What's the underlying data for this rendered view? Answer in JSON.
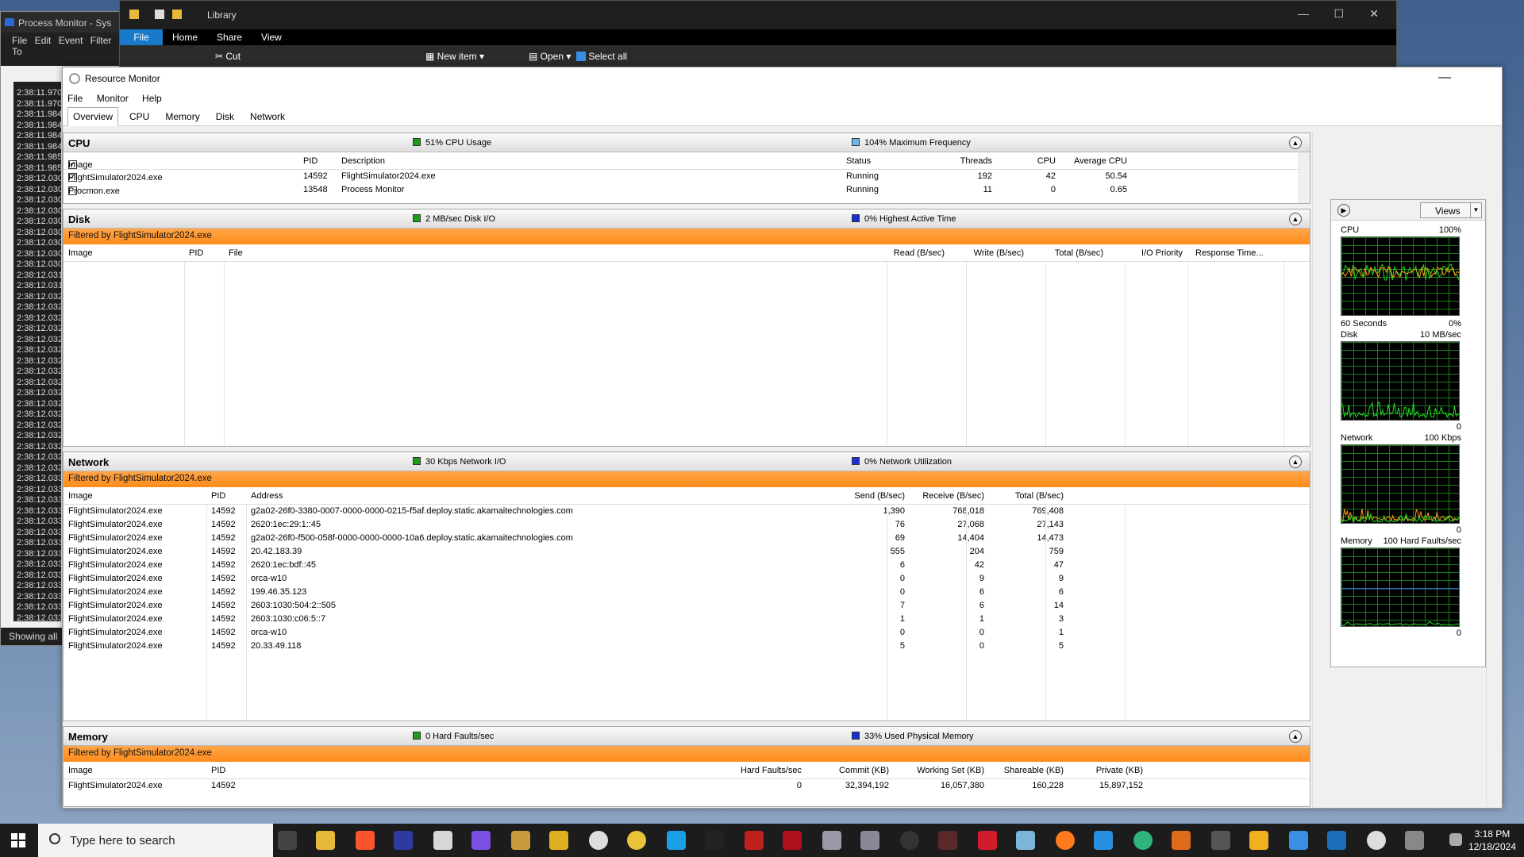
{
  "procmon": {
    "title": "Process Monitor - Sys",
    "menu": [
      "File",
      "Edit",
      "Event",
      "Filter",
      "To"
    ],
    "times": [
      "2:38:11.970",
      "2:38:11.970",
      "2:38:11.984",
      "2:38:11.984",
      "2:38:11.984",
      "2:38:11.984",
      "2:38:11.985",
      "2:38:11.985",
      "2:38:12.030",
      "2:38:12.030",
      "2:38:12.030",
      "2:38:12.030",
      "2:38:12.030",
      "2:38:12.030",
      "2:38:12.030",
      "2:38:12.030",
      "2:38:12.030",
      "2:38:12.031",
      "2:38:12.031",
      "2:38:12.032",
      "2:38:12.032",
      "2:38:12.032",
      "2:38:12.032",
      "2:38:12.032",
      "2:38:12.032",
      "2:38:12.032",
      "2:38:12.032",
      "2:38:12.032",
      "2:38:12.032",
      "2:38:12.032",
      "2:38:12.032",
      "2:38:12.032",
      "2:38:12.032",
      "2:38:12.032",
      "2:38:12.032",
      "2:38:12.032",
      "2:38:12.033",
      "2:38:12.033",
      "2:38:12.033",
      "2:38:12.033",
      "2:38:12.033",
      "2:38:12.033",
      "2:38:12.033",
      "2:38:12.033",
      "2:38:12.033",
      "2:38:12.033",
      "2:38:12.033",
      "2:38:12.033",
      "2:38:12.033",
      "2:38:12.033"
    ],
    "status": "Showing all"
  },
  "explorer": {
    "title": "Library",
    "ribbon": {
      "file": "File",
      "home": "Home",
      "share": "Share",
      "view": "View"
    },
    "tools": {
      "cut": "Cut",
      "new_item": "New item",
      "open": "Open",
      "select_all": "Select all"
    }
  },
  "rm": {
    "title": "Resource Monitor",
    "menu": {
      "file": "File",
      "monitor": "Monitor",
      "help": "Help"
    },
    "tabs": {
      "overview": "Overview",
      "cpu": "CPU",
      "memory": "Memory",
      "disk": "Disk",
      "network": "Network"
    },
    "cpu": {
      "name": "CPU",
      "ind1": "51% CPU Usage",
      "ind2": "104% Maximum Frequency",
      "cols": {
        "image": "Image",
        "pid": "PID",
        "desc": "Description",
        "status": "Status",
        "threads": "Threads",
        "cpu": "CPU",
        "avg": "Average CPU"
      },
      "rows": [
        {
          "checked": true,
          "image": "FlightSimulator2024.exe",
          "pid": "14592",
          "desc": "FlightSimulator2024.exe",
          "status": "Running",
          "threads": "192",
          "cpu": "42",
          "avg": "50.54"
        },
        {
          "checked": false,
          "image": "Procmon.exe",
          "pid": "13548",
          "desc": "Process Monitor",
          "status": "Running",
          "threads": "11",
          "cpu": "0",
          "avg": "0.65"
        }
      ]
    },
    "disk": {
      "name": "Disk",
      "ind1": "2 MB/sec Disk I/O",
      "ind2": "0% Highest Active Time",
      "filter": "Filtered by FlightSimulator2024.exe",
      "cols": {
        "image": "Image",
        "pid": "PID",
        "file": "File",
        "read": "Read (B/sec)",
        "write": "Write (B/sec)",
        "total": "Total (B/sec)",
        "prio": "I/O Priority",
        "resp": "Response Time..."
      }
    },
    "network": {
      "name": "Network",
      "ind1": "30 Kbps Network I/O",
      "ind2": "0% Network Utilization",
      "filter": "Filtered by FlightSimulator2024.exe",
      "cols": {
        "image": "Image",
        "pid": "PID",
        "address": "Address",
        "send": "Send (B/sec)",
        "recv": "Receive (B/sec)",
        "total": "Total (B/sec)"
      },
      "rows": [
        {
          "image": "FlightSimulator2024.exe",
          "pid": "14592",
          "address": "g2a02-26f0-3380-0007-0000-0000-0215-f5af.deploy.static.akamaitechnologies.com",
          "send": "1,390",
          "recv": "768,018",
          "total": "769,408"
        },
        {
          "image": "FlightSimulator2024.exe",
          "pid": "14592",
          "address": "2620:1ec:29:1::45",
          "send": "76",
          "recv": "27,068",
          "total": "27,143"
        },
        {
          "image": "FlightSimulator2024.exe",
          "pid": "14592",
          "address": "g2a02-26f0-f500-058f-0000-0000-0000-10a6.deploy.static.akamaitechnologies.com",
          "send": "69",
          "recv": "14,404",
          "total": "14,473"
        },
        {
          "image": "FlightSimulator2024.exe",
          "pid": "14592",
          "address": "20.42.183.39",
          "send": "555",
          "recv": "204",
          "total": "759"
        },
        {
          "image": "FlightSimulator2024.exe",
          "pid": "14592",
          "address": "2620:1ec:bdf::45",
          "send": "6",
          "recv": "42",
          "total": "47"
        },
        {
          "image": "FlightSimulator2024.exe",
          "pid": "14592",
          "address": "orca-w10",
          "send": "0",
          "recv": "9",
          "total": "9"
        },
        {
          "image": "FlightSimulator2024.exe",
          "pid": "14592",
          "address": "199.46.35.123",
          "send": "0",
          "recv": "6",
          "total": "6"
        },
        {
          "image": "FlightSimulator2024.exe",
          "pid": "14592",
          "address": "2603:1030:504:2::505",
          "send": "7",
          "recv": "6",
          "total": "14"
        },
        {
          "image": "FlightSimulator2024.exe",
          "pid": "14592",
          "address": "2603:1030:c06:5::7",
          "send": "1",
          "recv": "1",
          "total": "3"
        },
        {
          "image": "FlightSimulator2024.exe",
          "pid": "14592",
          "address": "orca-w10",
          "send": "0",
          "recv": "0",
          "total": "1"
        },
        {
          "image": "FlightSimulator2024.exe",
          "pid": "14592",
          "address": "20.33.49.118",
          "send": "5",
          "recv": "0",
          "total": "5"
        }
      ]
    },
    "memory": {
      "name": "Memory",
      "ind1": "0 Hard Faults/sec",
      "ind2": "33% Used Physical Memory",
      "filter": "Filtered by FlightSimulator2024.exe",
      "cols": {
        "image": "Image",
        "pid": "PID",
        "hf": "Hard Faults/sec",
        "commit": "Commit (KB)",
        "ws": "Working Set (KB)",
        "share": "Shareable (KB)",
        "priv": "Private (KB)"
      },
      "rows": [
        {
          "image": "FlightSimulator2024.exe",
          "pid": "14592",
          "hf": "0",
          "commit": "32,394,192",
          "ws": "16,057,380",
          "share": "160,228",
          "priv": "15,897,152"
        }
      ]
    },
    "graphs": {
      "views": "Views",
      "cpu": {
        "label": "CPU",
        "max": "100%",
        "time": "60 Seconds",
        "min": "0%"
      },
      "disk": {
        "label": "Disk",
        "max": "10 MB/sec",
        "min": "0"
      },
      "network": {
        "label": "Network",
        "max": "100 Kbps",
        "min": "0"
      },
      "memory": {
        "label": "Memory",
        "max": "100 Hard Faults/sec",
        "min": "0"
      }
    },
    "colors": {
      "filter": "#ff8c1a",
      "green": "#1a9e1a",
      "blue": "#1a2fd0",
      "graph_orange": "#ff9a1a"
    }
  },
  "taskbar": {
    "search_placeholder": "Type here to search",
    "time": "3:18 PM",
    "date": "12/18/2024"
  }
}
